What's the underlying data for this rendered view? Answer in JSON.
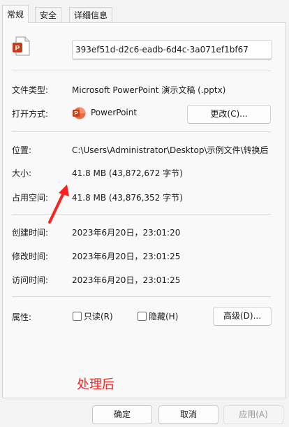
{
  "tabs": [
    {
      "label": "常规",
      "active": true
    },
    {
      "label": "安全",
      "active": false
    },
    {
      "label": "详细信息",
      "active": false
    }
  ],
  "file": {
    "icon": "powerpoint-file-icon",
    "name": "393ef51d-d2c6-eadb-6d4c-3a071ef1bf67"
  },
  "file_type": {
    "label": "文件类型:",
    "value": "Microsoft PowerPoint 演示文稿 (.pptx)"
  },
  "opens_with": {
    "label": "打开方式:",
    "app_icon": "powerpoint-app-icon",
    "app": "PowerPoint",
    "change_button": "更改(C)..."
  },
  "location": {
    "label": "位置:",
    "value": "C:\\Users\\Administrator\\Desktop\\示例文件\\转换后"
  },
  "size": {
    "label": "大小:",
    "value": "41.8 MB (43,872,672 字节)"
  },
  "size_on_disk": {
    "label": "占用空间:",
    "value": "41.8 MB (43,876,352 字节)"
  },
  "created": {
    "label": "创建时间:",
    "value": "2023年6月20日，23:01:20"
  },
  "modified": {
    "label": "修改时间:",
    "value": "2023年6月20日，23:01:25"
  },
  "accessed": {
    "label": "访问时间:",
    "value": "2023年6月20日，23:01:25"
  },
  "attributes": {
    "label": "属性:",
    "readonly": {
      "label": "只读(R)",
      "checked": false
    },
    "hidden": {
      "label": "隐藏(H)",
      "checked": false
    },
    "advanced_button": "高级(D)..."
  },
  "annotation": {
    "text": "处理后",
    "color": "#ff2020",
    "arrow_icon": "red-arrow-icon"
  },
  "footer": {
    "ok": "确定",
    "cancel": "取消",
    "apply": "应用(A)"
  },
  "colors": {
    "ppt_brand": "#c43e1c",
    "annotation": "#ff2020"
  }
}
